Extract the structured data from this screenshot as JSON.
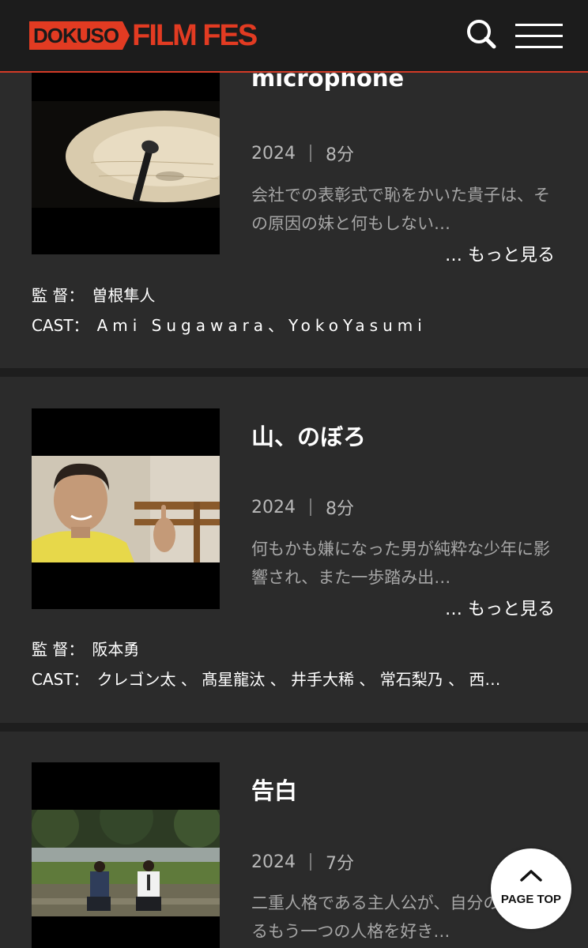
{
  "header": {
    "logo_box": "DOKUSO",
    "logo_text": "FILM FES"
  },
  "films": [
    {
      "title": "microphone",
      "year": "2024",
      "duration": "8分",
      "synopsis": "会社での表彰式で恥をかいた貴子は、その原因の妹と何もしない…",
      "more": "… もっと見る",
      "director_label": "監 督：",
      "director": "曽根隼人",
      "cast_label": "CAST：",
      "cast": "Ami Sugawara、YokoYasumi"
    },
    {
      "title": "山、のぼろ",
      "year": "2024",
      "duration": "8分",
      "synopsis": "何もかも嫌になった男が純粋な少年に影響され、また一歩踏み出…",
      "more": "… もっと見る",
      "director_label": "監 督：",
      "director": "阪本勇",
      "cast_label": "CAST：",
      "cast": "クレゴン太 、 髙星龍汰 、 井手大稀 、 常石梨乃 、 西…"
    },
    {
      "title": "告白",
      "year": "2024",
      "duration": "7分",
      "synopsis": "二重人格である主人公が、自分の中にいるもう一つの人格を好き…"
    }
  ],
  "page_top": {
    "label": "PAGE TOP"
  },
  "colors": {
    "accent": "#e23b22",
    "background": "#2b2b2b",
    "header": "#1c1c1c"
  },
  "icons": {
    "search": "search-icon",
    "menu": "hamburger-menu-icon",
    "page_top": "chevron-up-icon"
  }
}
